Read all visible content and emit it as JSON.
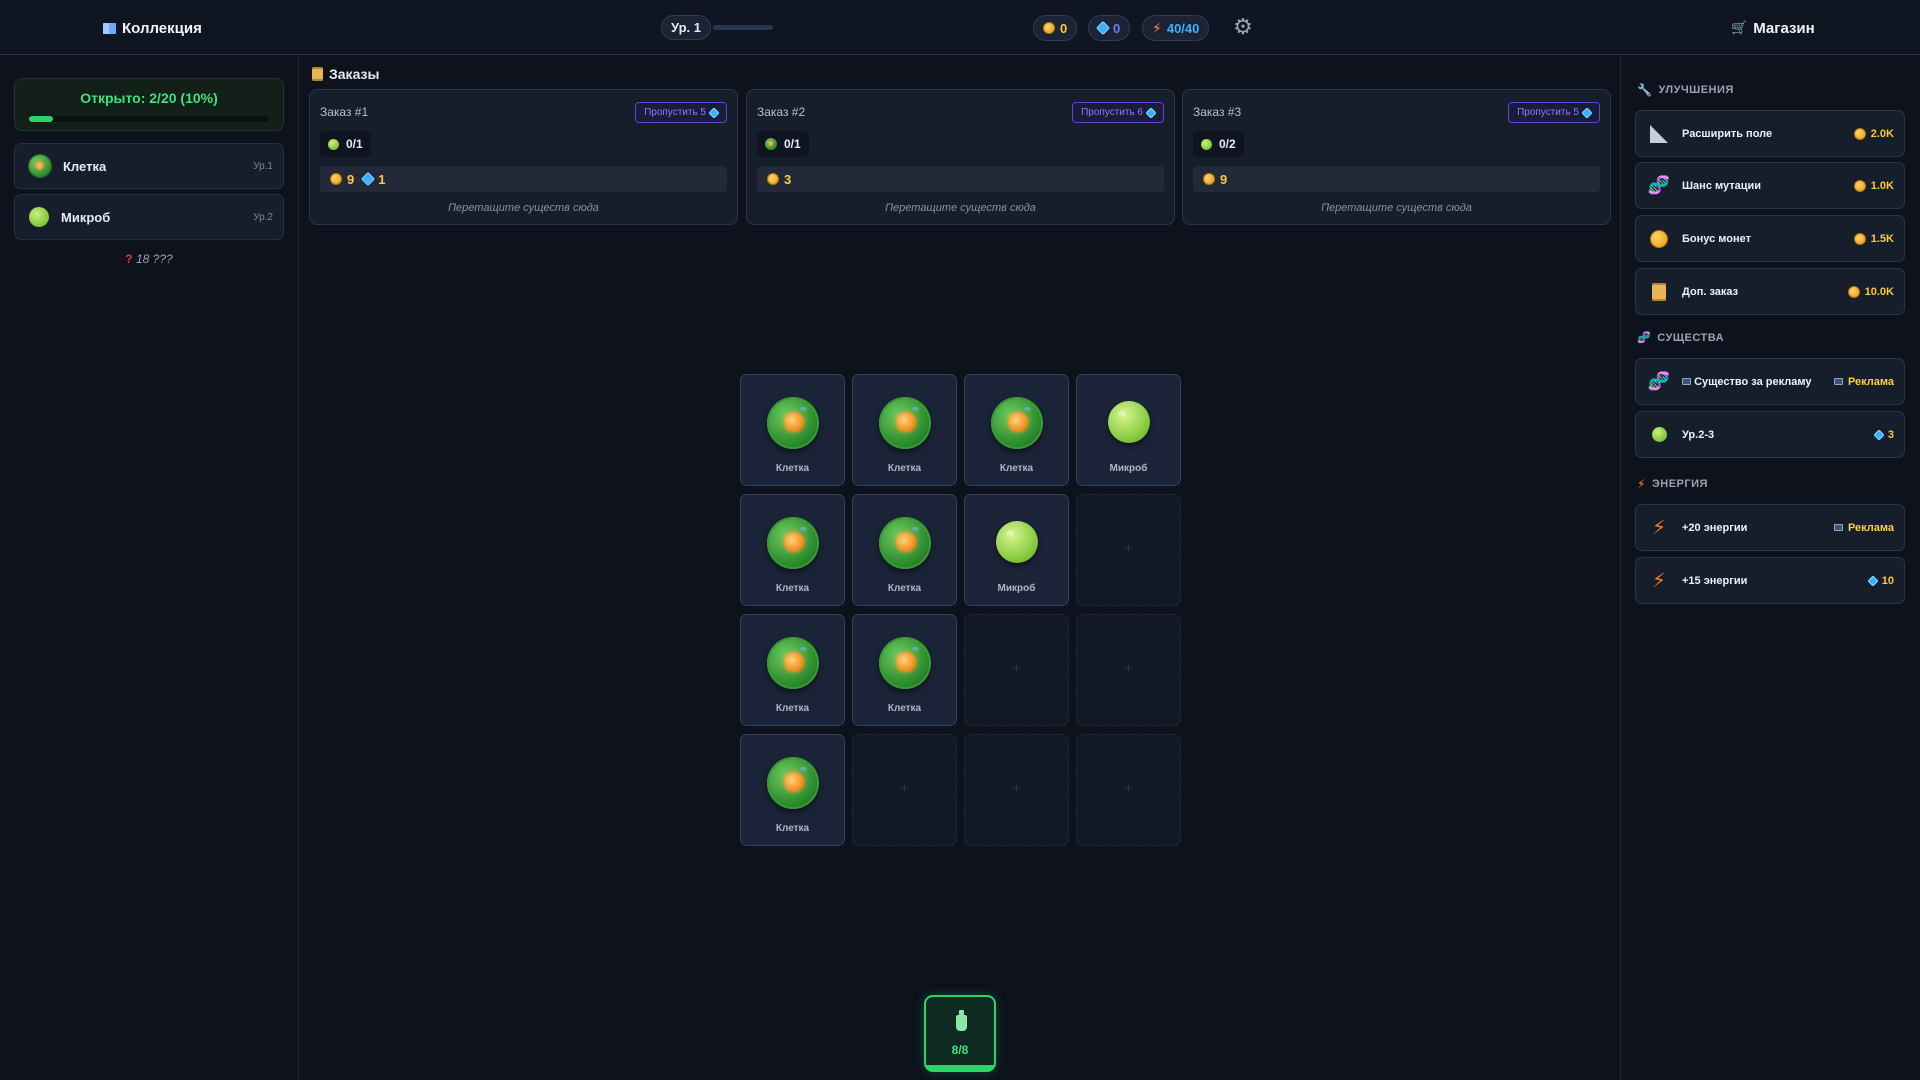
{
  "topbar": {
    "collection_label": "Коллекция",
    "level_label": "Ур. 1",
    "xp_fraction": 0.0,
    "coins": "0",
    "gems": "0",
    "energy": "40/40",
    "shop_label": "Магазин"
  },
  "collection": {
    "progress_text": "Открыто: 2/20 (10%)",
    "progress_fraction": 0.1,
    "items": [
      {
        "name": "Клетка",
        "level": "Ур.1"
      },
      {
        "name": "Микроб",
        "level": "Ур.2"
      }
    ],
    "unknown_text": "18 ???"
  },
  "orders": {
    "title": "Заказы",
    "drop_hint": "Перетащите существ сюда",
    "list": [
      {
        "title": "Заказ #1",
        "skip_label": "Пропустить 5",
        "req_progress": "0/1",
        "req_type": "microbe",
        "reward_coins": "9",
        "reward_gems": "1"
      },
      {
        "title": "Заказ #2",
        "skip_label": "Пропустить 6",
        "req_progress": "0/1",
        "req_type": "cell",
        "reward_coins": "3",
        "reward_gems": ""
      },
      {
        "title": "Заказ #3",
        "skip_label": "Пропустить 5",
        "req_progress": "0/2",
        "req_type": "microbe",
        "reward_coins": "9",
        "reward_gems": ""
      }
    ]
  },
  "board": {
    "cells": [
      {
        "type": "cell",
        "label": "Клетка"
      },
      {
        "type": "cell",
        "label": "Клетка"
      },
      {
        "type": "cell",
        "label": "Клетка"
      },
      {
        "type": "microbe",
        "label": "Микроб"
      },
      {
        "type": "cell",
        "label": "Клетка"
      },
      {
        "type": "cell",
        "label": "Клетка"
      },
      {
        "type": "microbe",
        "label": "Микроб"
      },
      {
        "type": "empty",
        "label": ""
      },
      {
        "type": "cell",
        "label": "Клетка"
      },
      {
        "type": "cell",
        "label": "Клетка"
      },
      {
        "type": "empty",
        "label": ""
      },
      {
        "type": "empty",
        "label": ""
      },
      {
        "type": "cell",
        "label": "Клетка"
      },
      {
        "type": "empty",
        "label": ""
      },
      {
        "type": "empty",
        "label": ""
      },
      {
        "type": "empty",
        "label": ""
      }
    ]
  },
  "spawn": {
    "count": "8/8",
    "fill_fraction": 1.0
  },
  "shop": {
    "upgrades_title": "УЛУЧШЕНИЯ",
    "upgrades": [
      {
        "name": "Расширить поле",
        "price": "2.0K",
        "icon": "ruler-icon"
      },
      {
        "name": "Шанс мутации",
        "price": "1.0K",
        "icon": "dna-icon"
      },
      {
        "name": "Бонус монет",
        "price": "1.5K",
        "icon": "coin-icon"
      },
      {
        "name": "Доп. заказ",
        "price": "10.0K",
        "icon": "scroll-icon"
      }
    ],
    "creatures_title": "СУЩЕСТВА",
    "creature_ad_name": "Существо за рекламу",
    "creature_ad_price": "Реклама",
    "creature_buy_name": "Ур.2-3",
    "creature_buy_price": "3",
    "energy_title": "ЭНЕРГИЯ",
    "energy_ad_name": "+20 энергии",
    "energy_ad_price": "Реклама",
    "energy_buy_name": "+15 энергии",
    "energy_buy_price": "10"
  },
  "colors": {
    "accent_green": "#2fd36e",
    "coin_gold": "#ffc93a",
    "gem_blue": "#3ab0ff",
    "skip_purple": "#8a7bff",
    "energy_orange": "#ff8a2a"
  }
}
